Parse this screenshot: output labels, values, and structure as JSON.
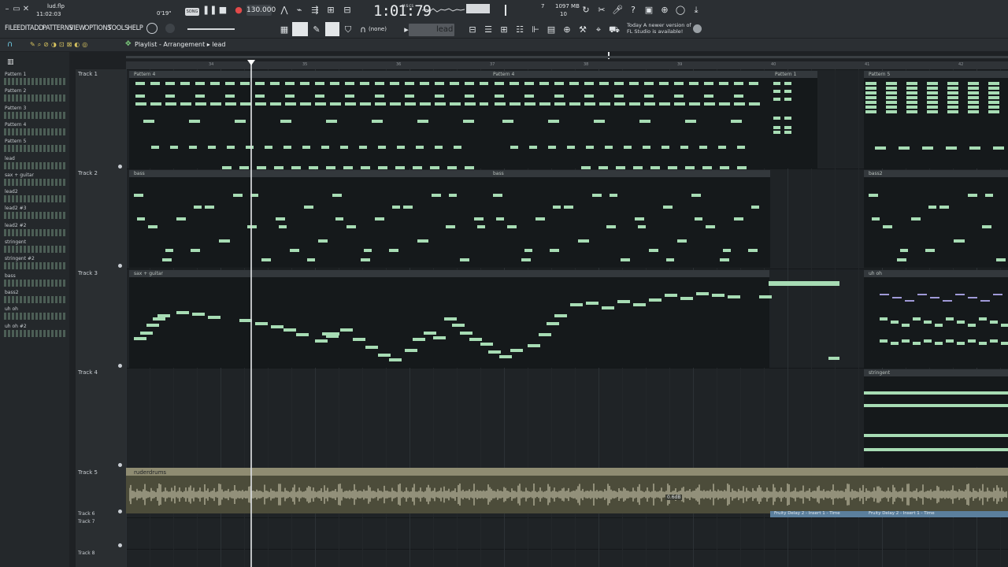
{
  "window": {
    "filename": "lud.flp",
    "time": "11:02:03"
  },
  "transport": {
    "elapsed": "0'19\"",
    "song_label": "SONG",
    "bpm": "130.000",
    "time": "1:01:79",
    "time_unit": "M:S:CS",
    "cpu": "7",
    "memory": "1097 MB",
    "voices": "10"
  },
  "menu": [
    "FILE",
    "EDIT",
    "ADD",
    "PATTERNS",
    "VIEW",
    "OPTIONS",
    "TOOLS",
    "HELP"
  ],
  "toolbar": {
    "snap": "(none)",
    "pattern": "lead"
  },
  "hint": {
    "day": "Today",
    "message": "A newer version of FL Studio is available!"
  },
  "breadcrumb": {
    "window": "Playlist - Arrangement",
    "pattern": "lead"
  },
  "picker": [
    "Pattern 1",
    "Pattern 2",
    "Pattern 3",
    "Pattern 4",
    "Pattern 5",
    "lead",
    "sax + guitar",
    "lead2",
    "lead2 #3",
    "lead2 #2",
    "stringent",
    "stringent #2",
    "bass",
    "bass2",
    "uh oh",
    "uh oh #2"
  ],
  "tracks": [
    "Track 1",
    "Track 2",
    "Track 3",
    "Track 4",
    "Track 5",
    "Track 6",
    "Track 7",
    "Track 8"
  ],
  "ruler": [
    "34",
    "35",
    "36",
    "37",
    "38",
    "39",
    "40",
    "41",
    "42"
  ],
  "clips": {
    "t1": [
      "Pattern 4",
      "Pattern 4",
      "Pattern 1",
      "Pattern 5"
    ],
    "t2": [
      "bass",
      "bass",
      "bass2"
    ],
    "t3": [
      "sax + guitar",
      "uh oh"
    ],
    "t4": [
      "stringent"
    ],
    "t5": "ruderdrums",
    "t6": [
      "Fruity Delay 2 - Insert 1 - Time",
      "Fruity Delay 2 - Insert 1 - Time"
    ]
  },
  "audio_db": "0.6dB",
  "colors": {
    "note": "#a7dcb4",
    "audio": "#8f8c72",
    "automation": "#5b7f9d"
  }
}
